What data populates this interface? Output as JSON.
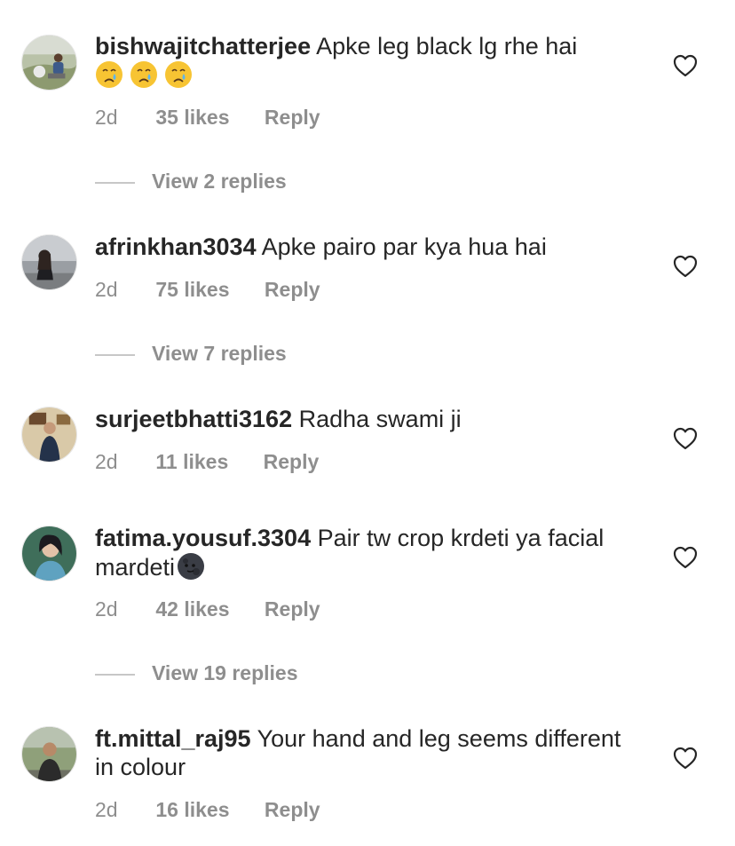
{
  "comments": [
    {
      "username": "bishwajitchatterjee",
      "text": "Apke leg black lg rhe hai",
      "emojis": [
        "crying-face",
        "crying-face",
        "crying-face"
      ],
      "time": "2d",
      "likes": "35 likes",
      "reply": "Reply",
      "view_replies": "View 2 replies"
    },
    {
      "username": "afrinkhan3034",
      "text": "Apke pairo par kya hua hai",
      "time": "2d",
      "likes": "75 likes",
      "reply": "Reply",
      "view_replies": "View 7 replies"
    },
    {
      "username": "surjeetbhatti3162",
      "text": "Radha swami ji",
      "time": "2d",
      "likes": "11 likes",
      "reply": "Reply"
    },
    {
      "username": "fatima.yousuf.3304",
      "text": "Pair tw crop krdeti ya facial mardeti",
      "emojis": [
        "new-moon-face"
      ],
      "time": "2d",
      "likes": "42 likes",
      "reply": "Reply",
      "view_replies": "View 19 replies"
    },
    {
      "username": "ft.mittal_raj95",
      "text": "Your hand and leg seems different in colour",
      "time": "2d",
      "likes": "16 likes",
      "reply": "Reply"
    }
  ],
  "icons": {
    "like": "heart-outline-icon"
  },
  "colors": {
    "text": "#262626",
    "secondary": "#8e8e8e",
    "divider": "#c7c7c7"
  }
}
